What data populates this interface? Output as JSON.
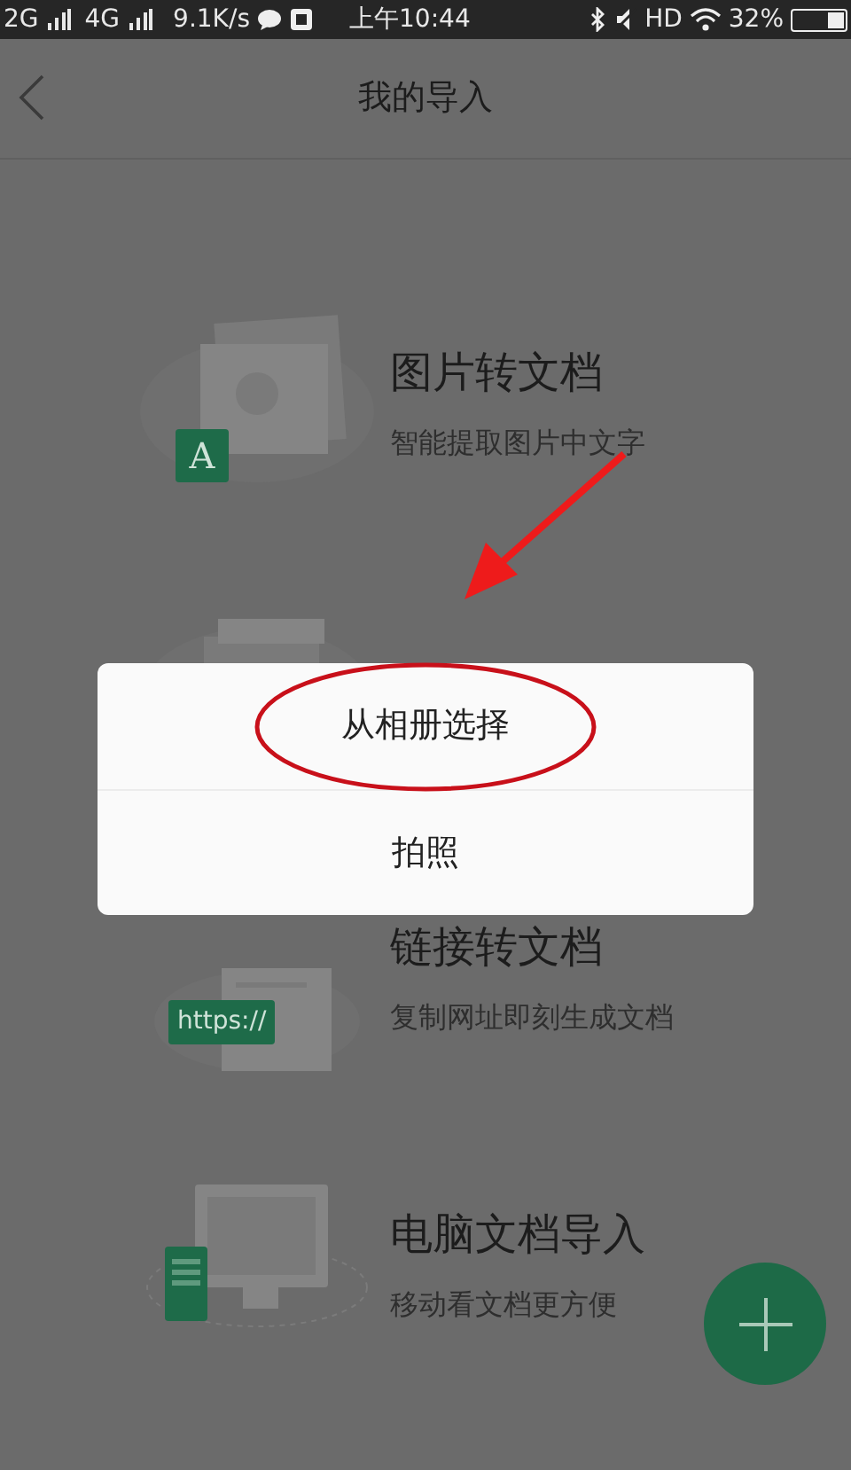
{
  "status_bar": {
    "network_1": "2G",
    "network_2": "4G",
    "speed": "9.1K/s",
    "time": "上午10:44",
    "hd": "HD",
    "battery": "32%"
  },
  "header": {
    "title": "我的导入"
  },
  "items": [
    {
      "kind": "image",
      "title": "图片转文档",
      "subtitle": "智能提取图片中文字",
      "badge": "A"
    },
    {
      "kind": "voice"
    },
    {
      "kind": "link",
      "title": "链接转文档",
      "subtitle": "复制网址即刻生成文档",
      "badge": "https://"
    },
    {
      "kind": "computer",
      "title": "电脑文档导入",
      "subtitle": "移动看文档更方便"
    }
  ],
  "dialog": {
    "options": [
      {
        "label": "从相册选择",
        "circled": true
      },
      {
        "label": "拍照",
        "circled": false
      }
    ]
  },
  "annotation_arrow": true
}
